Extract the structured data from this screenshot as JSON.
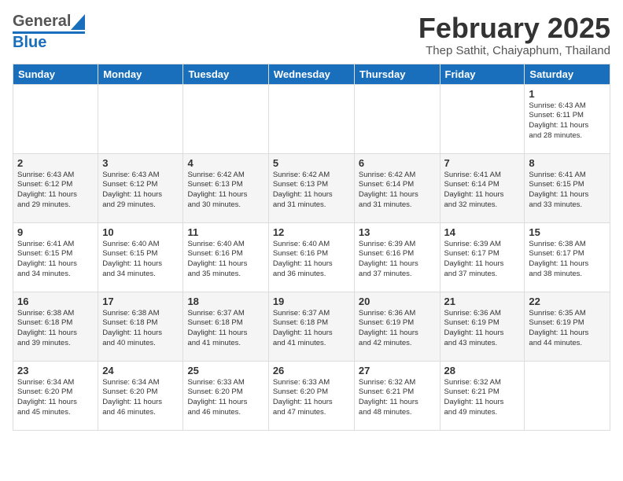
{
  "header": {
    "logo_general": "General",
    "logo_blue": "Blue",
    "title": "February 2025",
    "subtitle": "Thep Sathit, Chaiyaphum, Thailand"
  },
  "columns": [
    "Sunday",
    "Monday",
    "Tuesday",
    "Wednesday",
    "Thursday",
    "Friday",
    "Saturday"
  ],
  "weeks": [
    [
      {
        "day": "",
        "info": ""
      },
      {
        "day": "",
        "info": ""
      },
      {
        "day": "",
        "info": ""
      },
      {
        "day": "",
        "info": ""
      },
      {
        "day": "",
        "info": ""
      },
      {
        "day": "",
        "info": ""
      },
      {
        "day": "1",
        "info": "Sunrise: 6:43 AM\nSunset: 6:11 PM\nDaylight: 11 hours\nand 28 minutes."
      }
    ],
    [
      {
        "day": "2",
        "info": "Sunrise: 6:43 AM\nSunset: 6:12 PM\nDaylight: 11 hours\nand 29 minutes."
      },
      {
        "day": "3",
        "info": "Sunrise: 6:43 AM\nSunset: 6:12 PM\nDaylight: 11 hours\nand 29 minutes."
      },
      {
        "day": "4",
        "info": "Sunrise: 6:42 AM\nSunset: 6:13 PM\nDaylight: 11 hours\nand 30 minutes."
      },
      {
        "day": "5",
        "info": "Sunrise: 6:42 AM\nSunset: 6:13 PM\nDaylight: 11 hours\nand 31 minutes."
      },
      {
        "day": "6",
        "info": "Sunrise: 6:42 AM\nSunset: 6:14 PM\nDaylight: 11 hours\nand 31 minutes."
      },
      {
        "day": "7",
        "info": "Sunrise: 6:41 AM\nSunset: 6:14 PM\nDaylight: 11 hours\nand 32 minutes."
      },
      {
        "day": "8",
        "info": "Sunrise: 6:41 AM\nSunset: 6:15 PM\nDaylight: 11 hours\nand 33 minutes."
      }
    ],
    [
      {
        "day": "9",
        "info": "Sunrise: 6:41 AM\nSunset: 6:15 PM\nDaylight: 11 hours\nand 34 minutes."
      },
      {
        "day": "10",
        "info": "Sunrise: 6:40 AM\nSunset: 6:15 PM\nDaylight: 11 hours\nand 34 minutes."
      },
      {
        "day": "11",
        "info": "Sunrise: 6:40 AM\nSunset: 6:16 PM\nDaylight: 11 hours\nand 35 minutes."
      },
      {
        "day": "12",
        "info": "Sunrise: 6:40 AM\nSunset: 6:16 PM\nDaylight: 11 hours\nand 36 minutes."
      },
      {
        "day": "13",
        "info": "Sunrise: 6:39 AM\nSunset: 6:16 PM\nDaylight: 11 hours\nand 37 minutes."
      },
      {
        "day": "14",
        "info": "Sunrise: 6:39 AM\nSunset: 6:17 PM\nDaylight: 11 hours\nand 37 minutes."
      },
      {
        "day": "15",
        "info": "Sunrise: 6:38 AM\nSunset: 6:17 PM\nDaylight: 11 hours\nand 38 minutes."
      }
    ],
    [
      {
        "day": "16",
        "info": "Sunrise: 6:38 AM\nSunset: 6:18 PM\nDaylight: 11 hours\nand 39 minutes."
      },
      {
        "day": "17",
        "info": "Sunrise: 6:38 AM\nSunset: 6:18 PM\nDaylight: 11 hours\nand 40 minutes."
      },
      {
        "day": "18",
        "info": "Sunrise: 6:37 AM\nSunset: 6:18 PM\nDaylight: 11 hours\nand 41 minutes."
      },
      {
        "day": "19",
        "info": "Sunrise: 6:37 AM\nSunset: 6:18 PM\nDaylight: 11 hours\nand 41 minutes."
      },
      {
        "day": "20",
        "info": "Sunrise: 6:36 AM\nSunset: 6:19 PM\nDaylight: 11 hours\nand 42 minutes."
      },
      {
        "day": "21",
        "info": "Sunrise: 6:36 AM\nSunset: 6:19 PM\nDaylight: 11 hours\nand 43 minutes."
      },
      {
        "day": "22",
        "info": "Sunrise: 6:35 AM\nSunset: 6:19 PM\nDaylight: 11 hours\nand 44 minutes."
      }
    ],
    [
      {
        "day": "23",
        "info": "Sunrise: 6:34 AM\nSunset: 6:20 PM\nDaylight: 11 hours\nand 45 minutes."
      },
      {
        "day": "24",
        "info": "Sunrise: 6:34 AM\nSunset: 6:20 PM\nDaylight: 11 hours\nand 46 minutes."
      },
      {
        "day": "25",
        "info": "Sunrise: 6:33 AM\nSunset: 6:20 PM\nDaylight: 11 hours\nand 46 minutes."
      },
      {
        "day": "26",
        "info": "Sunrise: 6:33 AM\nSunset: 6:20 PM\nDaylight: 11 hours\nand 47 minutes."
      },
      {
        "day": "27",
        "info": "Sunrise: 6:32 AM\nSunset: 6:21 PM\nDaylight: 11 hours\nand 48 minutes."
      },
      {
        "day": "28",
        "info": "Sunrise: 6:32 AM\nSunset: 6:21 PM\nDaylight: 11 hours\nand 49 minutes."
      },
      {
        "day": "",
        "info": ""
      }
    ]
  ]
}
